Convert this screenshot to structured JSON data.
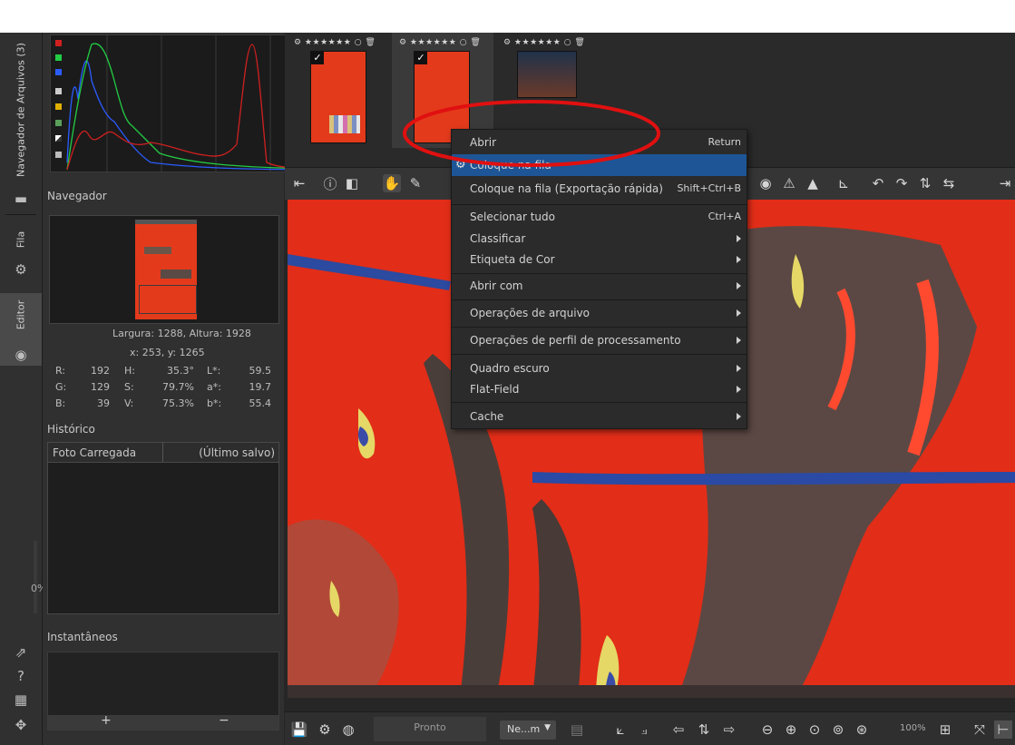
{
  "vertical_tabs": {
    "file_browser": "Navegador de Arquivos (3)",
    "queue": "Fila",
    "editor": "Editor",
    "zoom_percent": "0%"
  },
  "histogram": {
    "colors": {
      "red": "#d02020",
      "green": "#22cc44",
      "blue": "#2a5cff",
      "background": "#1b1b1b"
    }
  },
  "navigator": {
    "title": "Navegador",
    "size_text": "Largura: 1288, Altura: 1928",
    "coords_text": "x: 253, y: 1265",
    "values": {
      "r_label": "R:",
      "r": "192",
      "h_label": "H:",
      "h": "35.3°",
      "l_label": "L*:",
      "l": "59.5",
      "g_label": "G:",
      "g": "129",
      "s_label": "S:",
      "s": "79.7%",
      "a_label": "a*:",
      "a": "19.7",
      "b_label": "B:",
      "b": "39",
      "v_label": "V:",
      "v": "75.3%",
      "bstar_label": "b*:",
      "bstar": "55.4"
    }
  },
  "history": {
    "title": "Histórico",
    "rows": [
      {
        "name": "Foto Carregada",
        "state": "(Último salvo)"
      }
    ]
  },
  "snapshots": {
    "title": "Instantâneos",
    "add_label": "+",
    "remove_label": "−"
  },
  "filmstrip": {
    "items": [
      {
        "meta": "⚙ ★★★★★★ ○ 🗑"
      },
      {
        "meta": "⚙ ★★★★★★ ○ 🗑"
      },
      {
        "meta": "⚙ ★★★★★★ ○ 🗑"
      }
    ]
  },
  "bottombar": {
    "status": "Pronto",
    "profile_select": "Ne...m",
    "zoom": "100%"
  },
  "context_menu": {
    "items": [
      {
        "label": "Abrir",
        "shortcut": "Return"
      },
      {
        "label": "Coloque na fila",
        "shortcut": ""
      },
      {
        "label": "Coloque na fila (Exportação rápida)",
        "shortcut": "Shift+Ctrl+B"
      },
      {
        "label": "Selecionar tudo",
        "shortcut": "Ctrl+A"
      },
      {
        "label": "Classificar",
        "shortcut": ""
      },
      {
        "label": "Etiqueta de Cor",
        "shortcut": ""
      },
      {
        "label": "Abrir com",
        "shortcut": ""
      },
      {
        "label": "Operações de arquivo",
        "shortcut": ""
      },
      {
        "label": "Operações de perfil de processamento",
        "shortcut": ""
      },
      {
        "label": "Quadro escuro",
        "shortcut": ""
      },
      {
        "label": "Flat-Field",
        "shortcut": ""
      },
      {
        "label": "Cache",
        "shortcut": ""
      }
    ],
    "highlight_color": "#1d5596",
    "annotation_color": "#e01010"
  }
}
